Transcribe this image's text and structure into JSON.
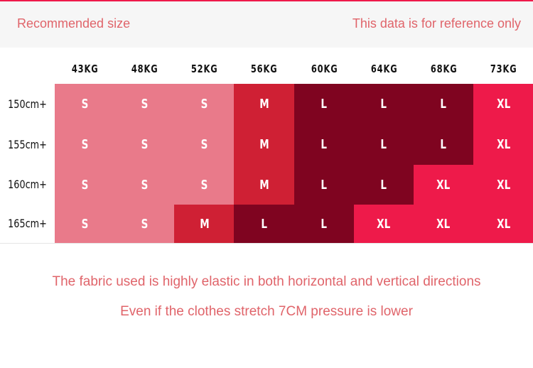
{
  "header": {
    "left": "Recommended size",
    "right": "This data is for reference only"
  },
  "colors": {
    "S": "#e97a8a",
    "M": "#cf2034",
    "L": "#7f0420",
    "XL": "#ee1a4a",
    "text": "#e0646a"
  },
  "weights": [
    "43KG",
    "48KG",
    "52KG",
    "56KG",
    "60KG",
    "64KG",
    "68KG",
    "73KG"
  ],
  "heights": [
    "150cm+",
    "155cm+",
    "160cm+",
    "165cm+"
  ],
  "sizes": [
    [
      "S",
      "S",
      "S",
      "M",
      "L",
      "L",
      "L",
      "XL"
    ],
    [
      "S",
      "S",
      "S",
      "M",
      "L",
      "L",
      "L",
      "XL"
    ],
    [
      "S",
      "S",
      "S",
      "M",
      "L",
      "L",
      "XL",
      "XL"
    ],
    [
      "S",
      "S",
      "M",
      "L",
      "L",
      "XL",
      "XL",
      "XL"
    ]
  ],
  "notes": [
    "The fabric used is highly elastic in both horizontal and vertical directions",
    "Even if the clothes stretch 7CM pressure is lower"
  ]
}
